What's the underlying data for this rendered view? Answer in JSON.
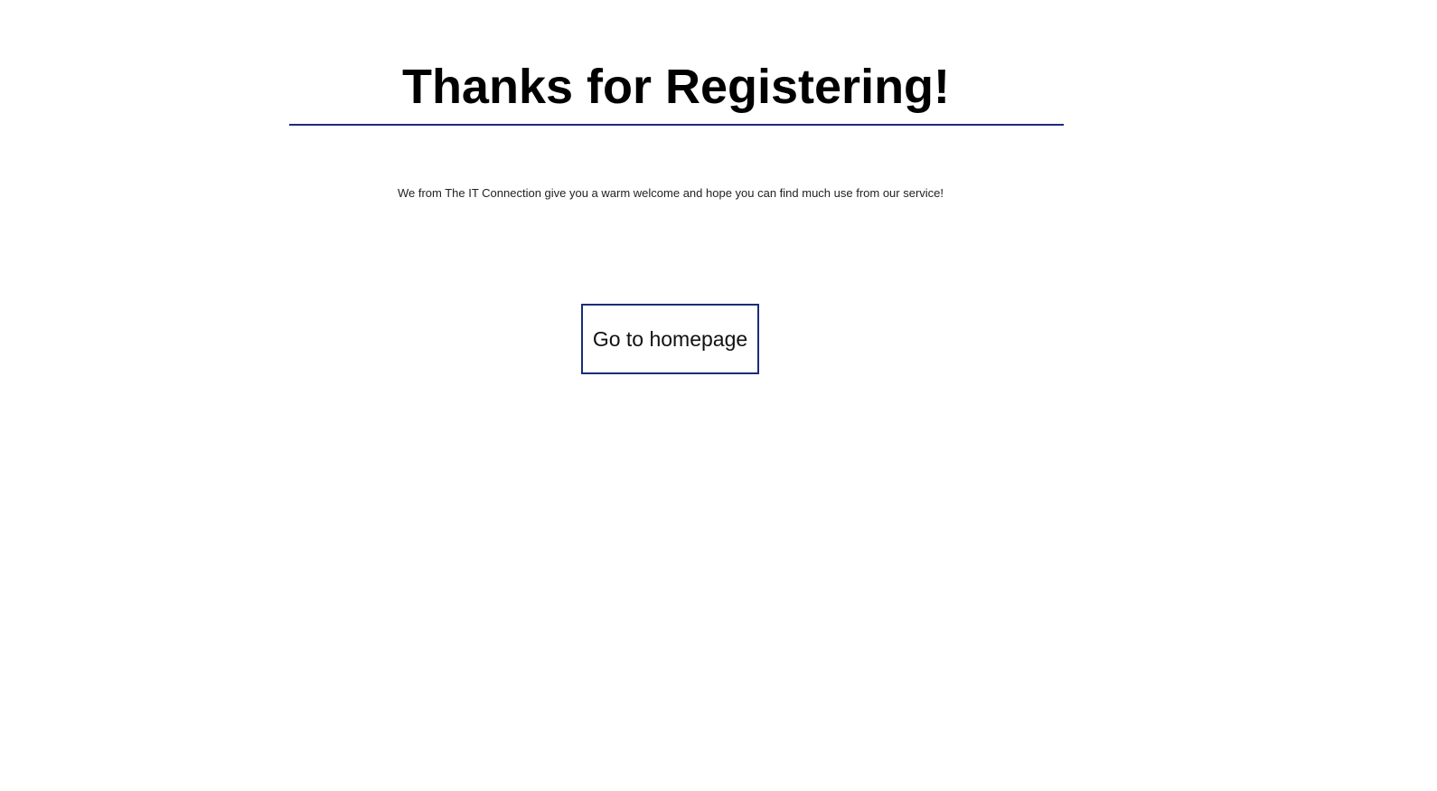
{
  "header": {
    "title": "Thanks for Registering!"
  },
  "main": {
    "welcome_text": "We from The IT Connection give you a warm welcome and hope you can find much use from our service!",
    "home_button_label": "Go to homepage"
  },
  "colors": {
    "accent": "#1a2c7a",
    "background": "#ffffff",
    "text": "#111111"
  }
}
